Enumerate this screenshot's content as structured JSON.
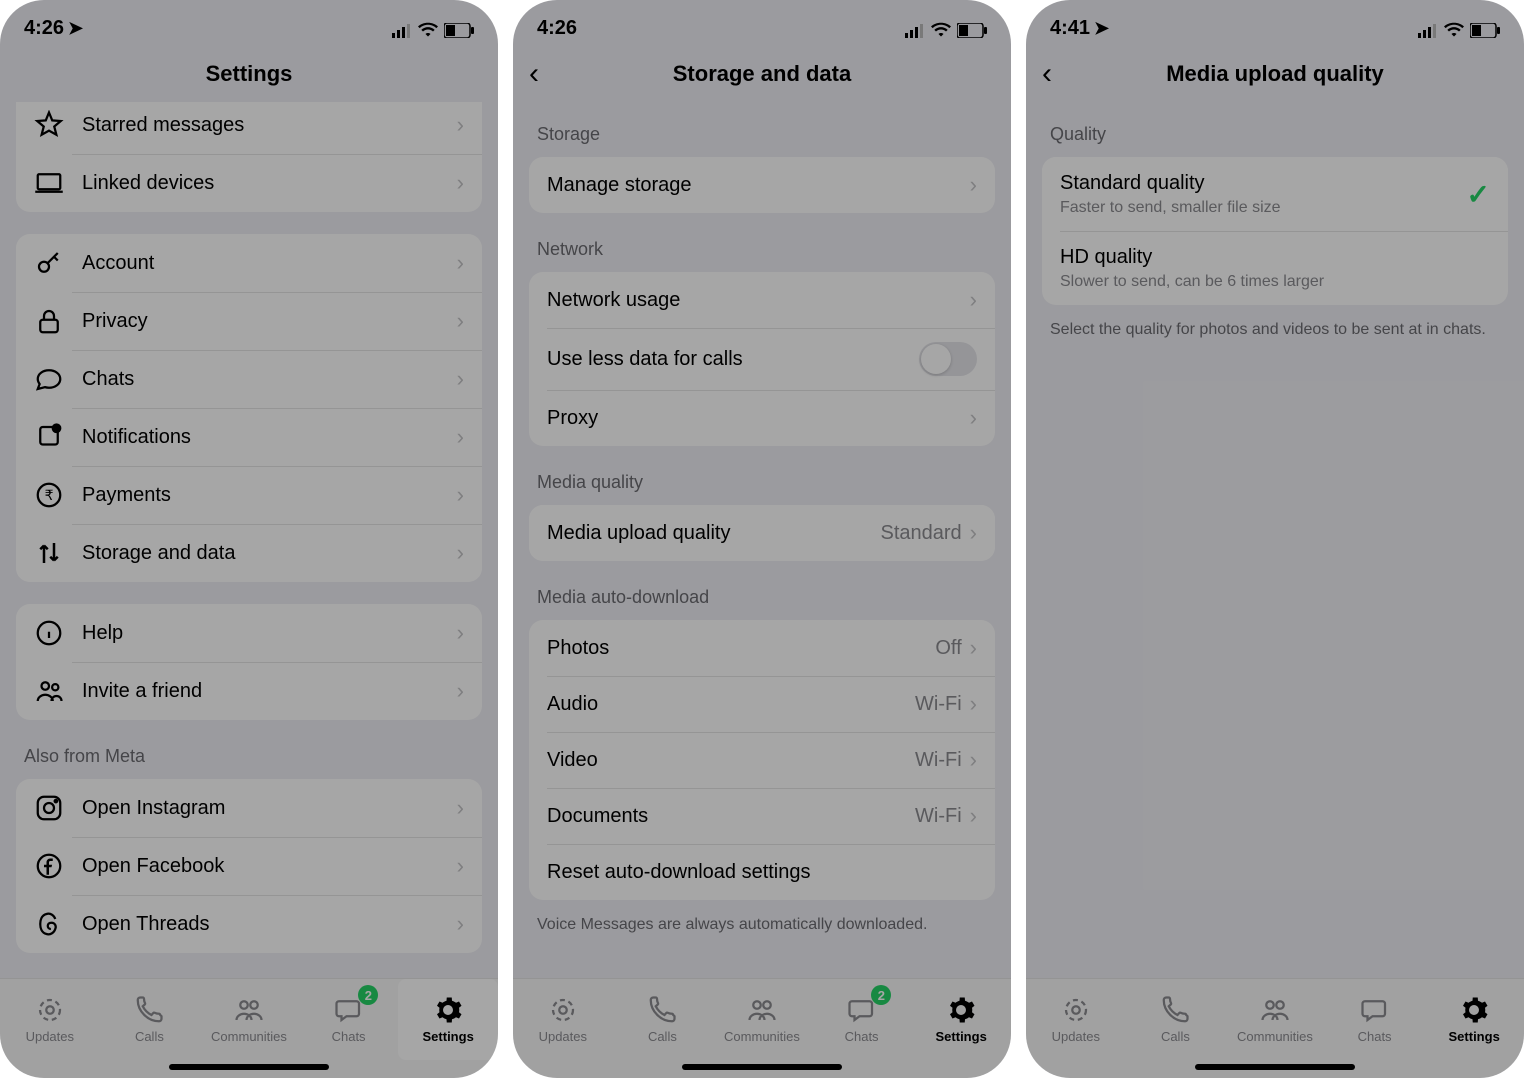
{
  "phone1": {
    "time": "4:26",
    "header": "Settings",
    "rows_top": [
      {
        "icon": "star",
        "label": "Starred messages"
      },
      {
        "icon": "laptop",
        "label": "Linked devices"
      }
    ],
    "rows_main": [
      {
        "icon": "key",
        "label": "Account"
      },
      {
        "icon": "lock",
        "label": "Privacy"
      },
      {
        "icon": "chat",
        "label": "Chats"
      },
      {
        "icon": "bell",
        "label": "Notifications"
      },
      {
        "icon": "rupee",
        "label": "Payments"
      },
      {
        "icon": "updown",
        "label": "Storage and data"
      }
    ],
    "rows_help": [
      {
        "icon": "info",
        "label": "Help"
      },
      {
        "icon": "people",
        "label": "Invite a friend"
      }
    ],
    "meta_header": "Also from Meta",
    "rows_meta": [
      {
        "icon": "instagram",
        "label": "Open Instagram"
      },
      {
        "icon": "facebook",
        "label": "Open Facebook"
      },
      {
        "icon": "threads",
        "label": "Open Threads"
      }
    ]
  },
  "phone2": {
    "time": "4:26",
    "header": "Storage and data",
    "sec_storage": "Storage",
    "manage_storage": "Manage storage",
    "sec_network": "Network",
    "network_usage": "Network usage",
    "use_less_data": "Use less data for calls",
    "proxy": "Proxy",
    "sec_media_quality": "Media quality",
    "media_upload_quality": "Media upload quality",
    "media_upload_value": "Standard",
    "sec_auto_download": "Media auto-download",
    "photos": "Photos",
    "photos_val": "Off",
    "audio": "Audio",
    "audio_val": "Wi-Fi",
    "video": "Video",
    "video_val": "Wi-Fi",
    "documents": "Documents",
    "documents_val": "Wi-Fi",
    "reset": "Reset auto-download settings",
    "voice_note": "Voice Messages are always automatically downloaded."
  },
  "phone3": {
    "time": "4:41",
    "header": "Media upload quality",
    "sec_quality": "Quality",
    "standard_title": "Standard quality",
    "standard_sub": "Faster to send, smaller file size",
    "hd_title": "HD quality",
    "hd_sub": "Slower to send, can be 6 times larger",
    "footnote": "Select the quality for photos and videos to be sent at in chats."
  },
  "tabs": {
    "updates": "Updates",
    "calls": "Calls",
    "communities": "Communities",
    "chats": "Chats",
    "settings": "Settings",
    "chats_badge": "2"
  }
}
